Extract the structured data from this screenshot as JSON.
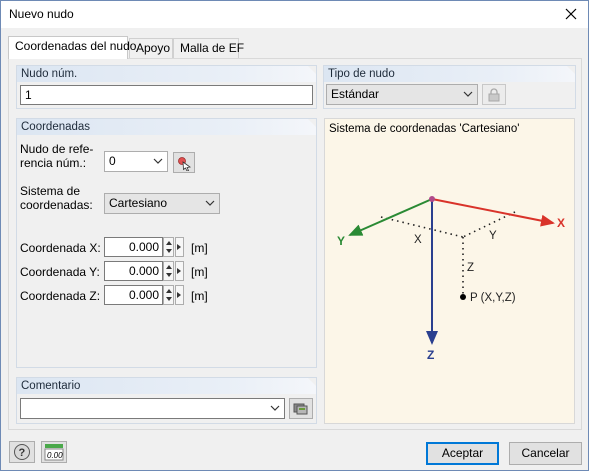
{
  "window": {
    "title": "Nuevo nudo"
  },
  "tabs": [
    {
      "label": "Coordenadas del nudo"
    },
    {
      "label": "Apoyo"
    },
    {
      "label": "Malla de EF"
    }
  ],
  "node_number": {
    "header": "Nudo núm.",
    "value": "1"
  },
  "node_type": {
    "header": "Tipo de nudo",
    "value": "Estándar"
  },
  "coordinates": {
    "header": "Coordenadas",
    "ref_node_label": "Nudo de refe-\nrencia núm.:",
    "ref_node_value": "0",
    "system_label": "Sistema de\ncoordenadas:",
    "system_value": "Cartesiano",
    "x_label": "Coordenada X:",
    "x_value": "0.000",
    "y_label": "Coordenada Y:",
    "y_value": "0.000",
    "z_label": "Coordenada Z:",
    "z_value": "0.000",
    "unit": "[m]"
  },
  "diagram": {
    "title": "Sistema de coordenadas 'Cartesiano'",
    "axis_x": "X",
    "axis_y": "Y",
    "axis_z": "Z",
    "dim_x": "X",
    "dim_y": "Y",
    "dim_z": "Z",
    "point_label": "P (X,Y,Z)"
  },
  "comment": {
    "header": "Comentario",
    "value": ""
  },
  "buttons": {
    "accept": "Aceptar",
    "cancel": "Cancelar"
  },
  "colors": {
    "x_axis": "#d9332a",
    "y_axis": "#2a8a34",
    "z_axis": "#2a3f8f",
    "origin": "#b04a8a"
  }
}
